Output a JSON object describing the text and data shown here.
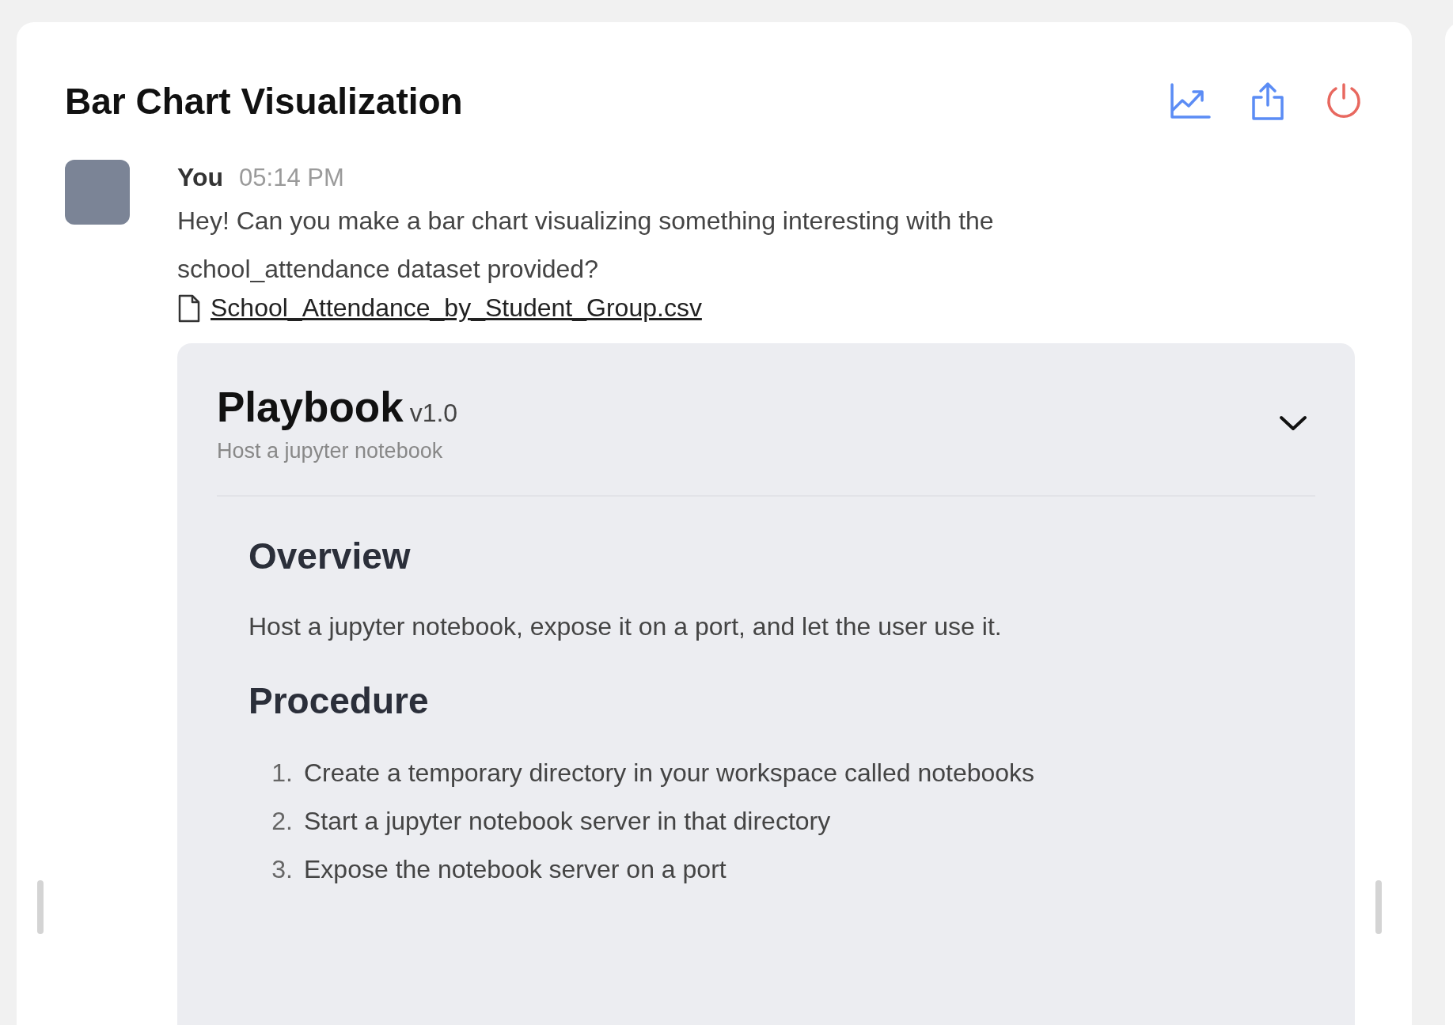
{
  "header": {
    "title": "Bar Chart Visualization"
  },
  "message": {
    "author": "You",
    "time": "05:14 PM",
    "text": "Hey! Can you make a bar chart visualizing something interesting with the school_attendance dataset provided?",
    "attachment": "School_Attendance_by_Student_Group.csv"
  },
  "playbook": {
    "title": "Playbook",
    "version": "v1.0",
    "subtitle": "Host a jupyter notebook",
    "expanded": true,
    "sections": [
      {
        "heading": "Overview",
        "kind": "paragraph",
        "text": "Host a jupyter notebook, expose it on a port, and let the user use it."
      },
      {
        "heading": "Procedure",
        "kind": "list",
        "items": [
          {
            "number": "1.",
            "text": "Create a temporary directory in your workspace called notebooks"
          },
          {
            "number": "2.",
            "text": "Start a jupyter notebook server in that directory"
          },
          {
            "number": "3.",
            "text": "Expose the notebook server on a port"
          }
        ]
      }
    ]
  }
}
